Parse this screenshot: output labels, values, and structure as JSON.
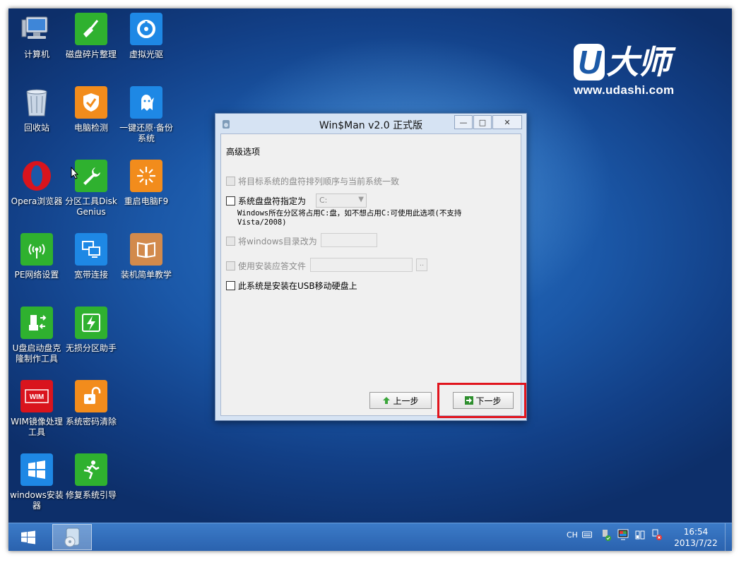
{
  "desktop": {
    "icons": [
      {
        "label": "计算机",
        "icon": "computer-icon"
      },
      {
        "label": "磁盘碎片整理",
        "icon": "broom-icon"
      },
      {
        "label": "虚拟光驱",
        "icon": "disc-icon"
      },
      {
        "label": "回收站",
        "icon": "recycle-bin-icon"
      },
      {
        "label": "电脑检测",
        "icon": "shield-check-icon"
      },
      {
        "label": "一键还原·备份系统",
        "icon": "ghost-icon"
      },
      {
        "label": "Opera浏览器",
        "icon": "opera-icon"
      },
      {
        "label": "分区工具DiskGenius",
        "icon": "wrench-icon"
      },
      {
        "label": "重启电脑F9",
        "icon": "sunburst-icon"
      },
      {
        "label": "PE网络设置",
        "icon": "wireless-icon"
      },
      {
        "label": "宽带连接",
        "icon": "monitors-icon"
      },
      {
        "label": "装机简单教学",
        "icon": "book-icon"
      },
      {
        "label": "U盘启动盘克隆制作工具",
        "icon": "usb-icon"
      },
      {
        "label": "无损分区助手",
        "icon": "bolt-icon"
      },
      {
        "label": "WIM镜像处理工具",
        "icon": "wim-icon"
      },
      {
        "label": "系统密码清除",
        "icon": "unlock-icon"
      },
      {
        "label": "windows安装器",
        "icon": "windows-icon"
      },
      {
        "label": "修复系统引导",
        "icon": "runner-icon"
      }
    ],
    "logo": {
      "mark_u": "U",
      "mark_text": "大师",
      "url": "www.udashi.com"
    }
  },
  "dialog": {
    "title": "Win$Man v2.0 正式版",
    "window_buttons": {
      "minimize": "—",
      "maximize": "□",
      "close": "✕"
    },
    "section_label": "高级选项",
    "option_keep_order": "将目标系统的盘符排列顺序与当前系统一致",
    "option_assign_letter": "系统盘盘符指定为",
    "drive_select_value": "C:",
    "assign_note_line1": "Windows所在分区将占用C:盘，如不想占用C:可使用此选项(不支持",
    "assign_note_line2": "Vista/2008)",
    "option_rename_windows": "将windows目录改为",
    "rename_value": "",
    "option_answer_file": "使用安装应答文件",
    "answer_file_value": "",
    "browse_label": "..",
    "option_usb": "此系统是安装在USB移动硬盘上",
    "prev_button": "上一步",
    "next_button": "下一步"
  },
  "taskbar": {
    "language": "CH",
    "time": "16:54",
    "date": "2013/7/22"
  },
  "colors": {
    "highlight": "#e1141d",
    "desktop_blue": "#1b58a8"
  }
}
